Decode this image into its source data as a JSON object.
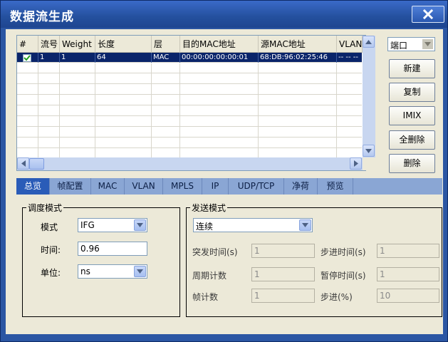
{
  "window": {
    "title": "数据流生成"
  },
  "grid": {
    "columns": [
      "#",
      "流号",
      "Weight",
      "长度",
      "层",
      "目的MAC地址",
      "源MAC地址",
      "VLAN"
    ],
    "rows": [
      {
        "flow": "1",
        "weight": "1",
        "length": "64",
        "layer": "MAC",
        "dst_mac": "00:00:00:00:00:01",
        "src_mac": "68:DB:96:02:25:46",
        "vlan": "-- -- --",
        "checked": true
      }
    ]
  },
  "side": {
    "port_select": "端口",
    "buttons": [
      "新建",
      "复制",
      "IMIX",
      "全删除",
      "删除"
    ]
  },
  "tabs": [
    "总览",
    "帧配置",
    "MAC",
    "VLAN",
    "MPLS",
    "IP",
    "UDP/TCP",
    "净荷",
    "预览"
  ],
  "active_tab": "总览",
  "schedule": {
    "title": "调度模式",
    "mode_label": "模式",
    "mode_value": "IFG",
    "time_label": "时间:",
    "time_value": "0.96",
    "unit_label": "单位:",
    "unit_value": "ns"
  },
  "send": {
    "title": "发送模式",
    "mode_value": "连续",
    "burst_time_label": "突发时间(s)",
    "burst_time_value": "1",
    "step_time_label": "步进时间(s)",
    "step_time_value": "1",
    "period_count_label": "周期计数",
    "period_count_value": "1",
    "pause_time_label": "暂停时间(s)",
    "pause_time_value": "1",
    "frame_count_label": "帧计数",
    "frame_count_value": "1",
    "step_pct_label": "步进(%)",
    "step_pct_value": "10"
  },
  "colors": {
    "title_bar": "#24509e",
    "selection": "#0a246a",
    "tab_active": "#2a5cb8",
    "tab_bar": "#8aa6d4"
  }
}
